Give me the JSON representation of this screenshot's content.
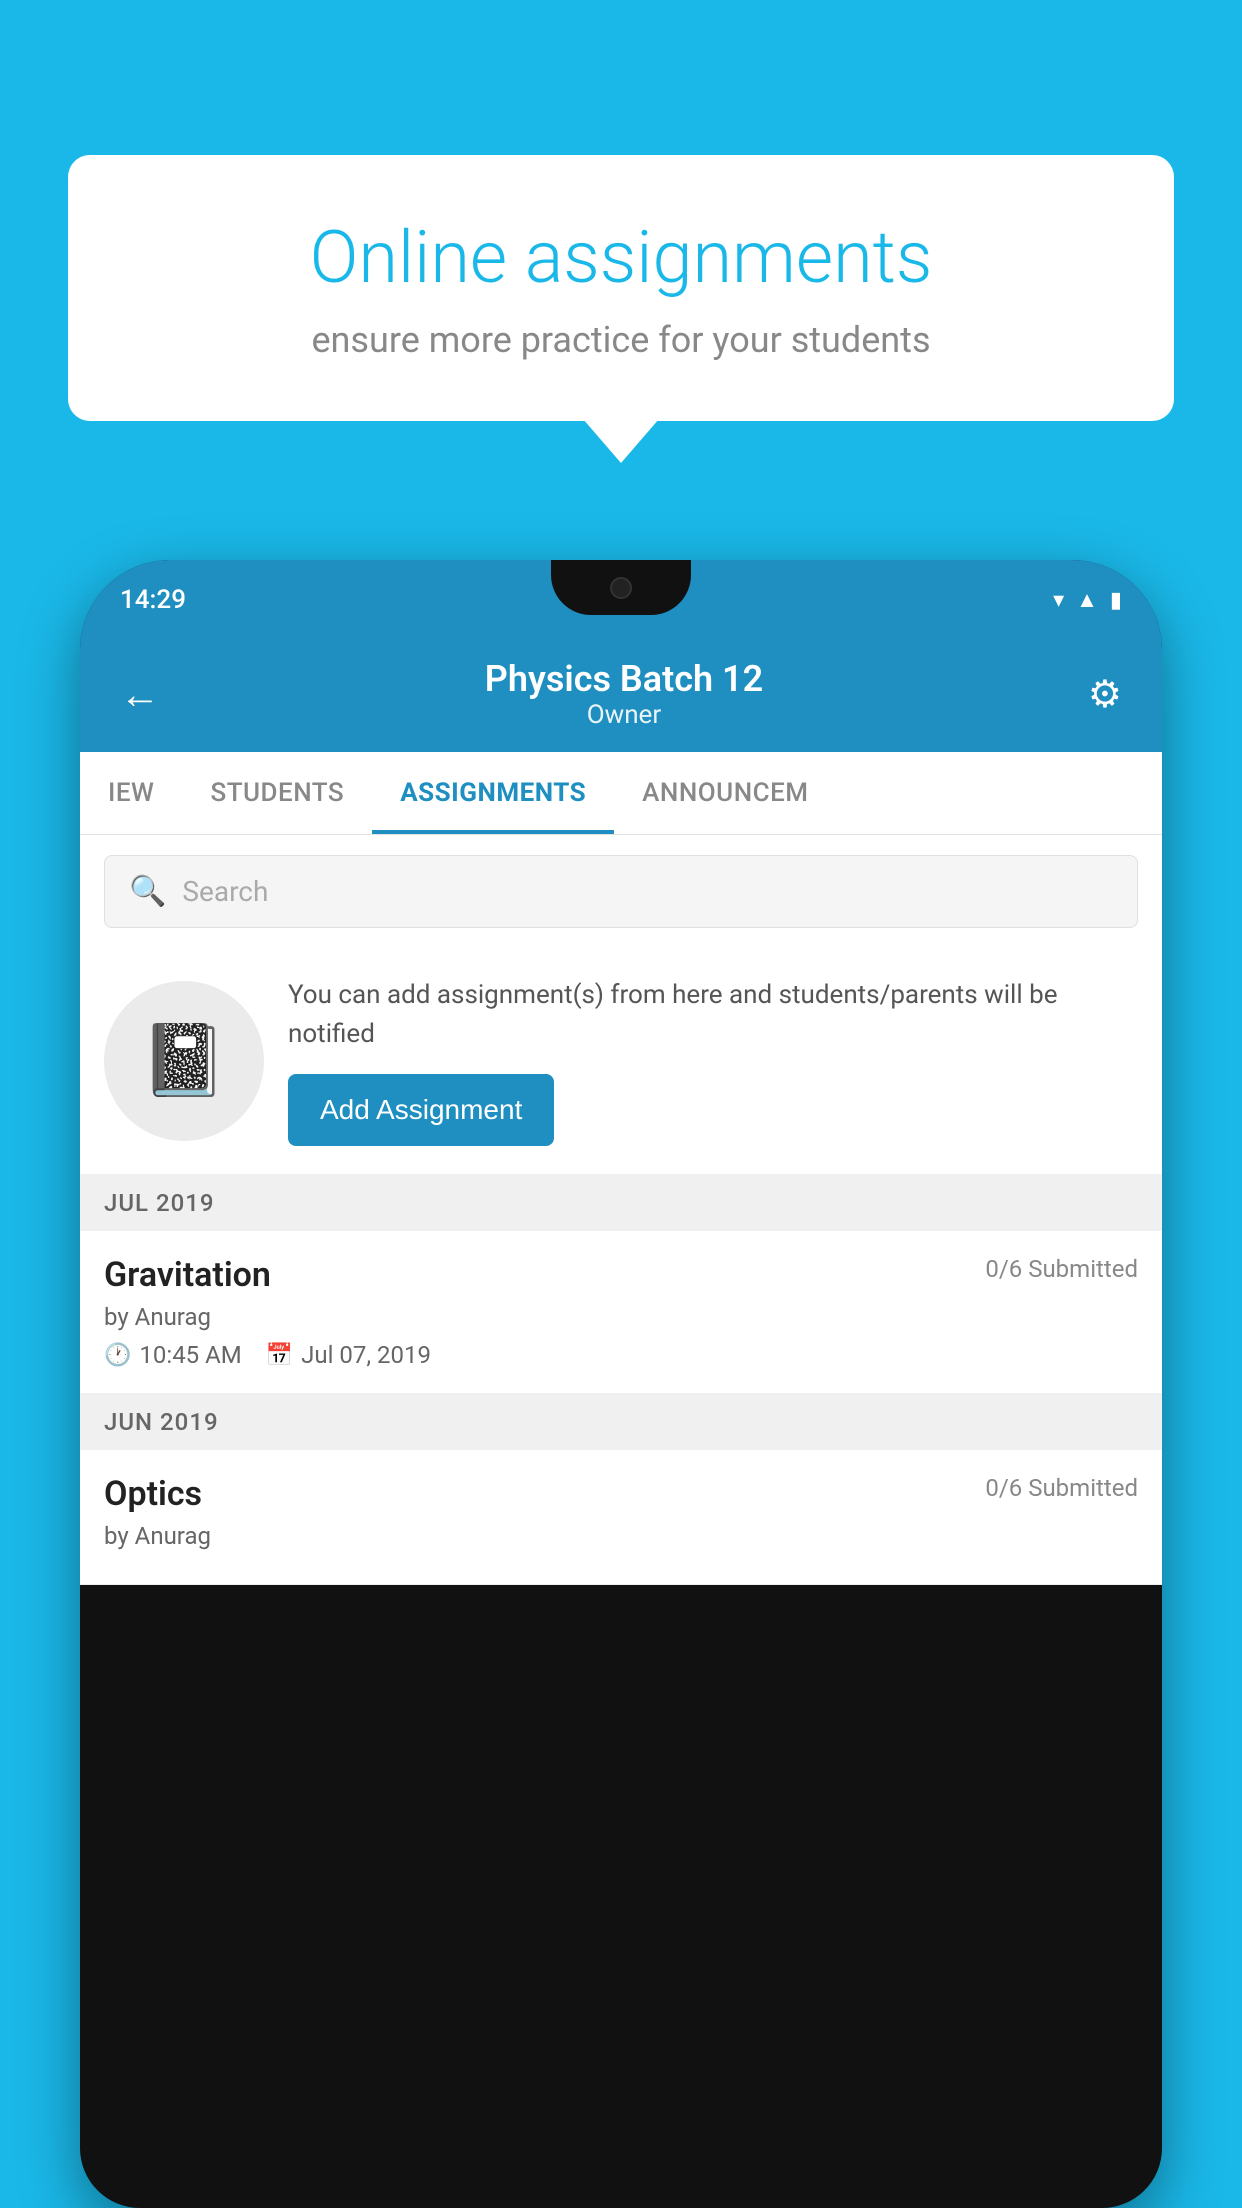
{
  "background": {
    "color": "#1ab8e8"
  },
  "speech_bubble": {
    "main_title": "Online assignments",
    "sub_title": "ensure more practice for your students"
  },
  "phone": {
    "status_bar": {
      "time": "14:29",
      "icons": [
        "wifi",
        "signal",
        "battery"
      ]
    },
    "header": {
      "title": "Physics Batch 12",
      "subtitle": "Owner",
      "back_label": "←",
      "gear_symbol": "⚙"
    },
    "tabs": [
      {
        "label": "IEW",
        "active": false
      },
      {
        "label": "STUDENTS",
        "active": false
      },
      {
        "label": "ASSIGNMENTS",
        "active": true
      },
      {
        "label": "ANNOUNCEM",
        "active": false
      }
    ],
    "search": {
      "placeholder": "Search"
    },
    "promo": {
      "description": "You can add assignment(s) from here and students/parents will be notified",
      "button_label": "Add Assignment"
    },
    "months": [
      {
        "label": "JUL 2019",
        "assignments": [
          {
            "name": "Gravitation",
            "submitted": "0/6 Submitted",
            "by": "by Anurag",
            "time": "10:45 AM",
            "date": "Jul 07, 2019"
          }
        ]
      },
      {
        "label": "JUN 2019",
        "assignments": [
          {
            "name": "Optics",
            "submitted": "0/6 Submitted",
            "by": "by Anurag",
            "time": "",
            "date": ""
          }
        ]
      }
    ]
  }
}
